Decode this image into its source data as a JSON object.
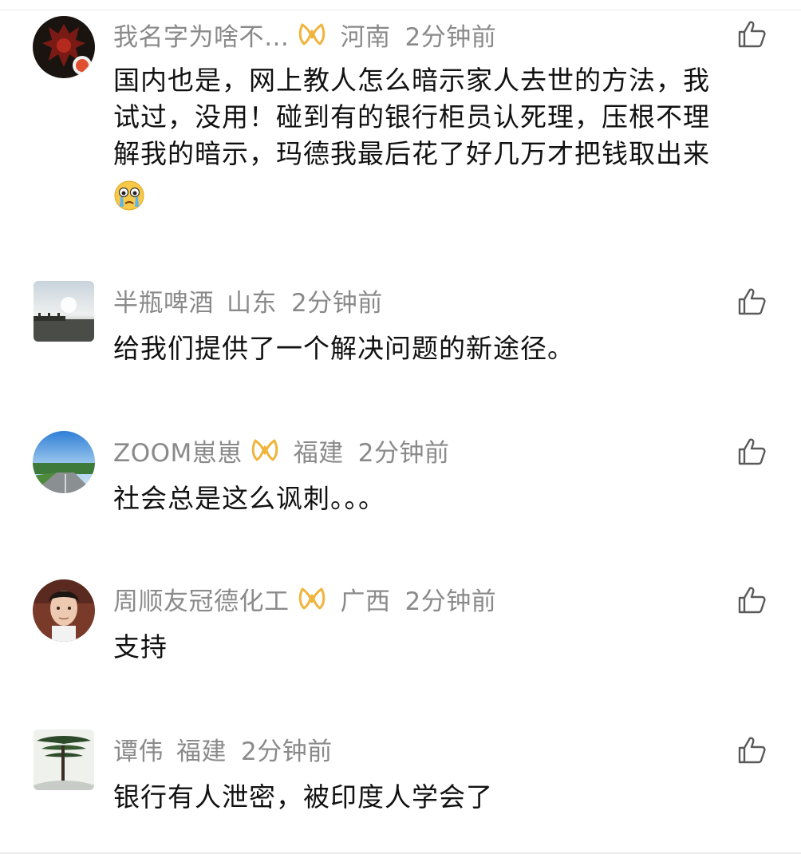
{
  "comments": [
    {
      "name": "我名字为啥不…",
      "location": "河南",
      "time": "2分钟前",
      "badge": "yellow-loop-badge",
      "avatar": "red-horde-emblem-avatar",
      "text_lines": [
        "国内也是，网上教人怎么暗示家人去世的方法，我",
        "试过，没用！碰到有的银行柜员认死理，压根不理",
        "解我的暗示，玛德我最后花了好几万才把钱取出来"
      ],
      "emoji": "crying-emoji"
    },
    {
      "name": "半瓶啤酒",
      "location": "山东",
      "time": "2分钟前",
      "avatar": "sky-bridge-photo-avatar",
      "text": "给我们提供了一个解决问题的新途径。"
    },
    {
      "name": "ZOOM崽崽",
      "location": "福建",
      "time": "2分钟前",
      "badge": "yellow-loop-badge",
      "avatar": "road-sky-photo-avatar",
      "text": "社会总是这么讽刺。。。"
    },
    {
      "name": "周顺友冠德化工",
      "location": "广西",
      "time": "2分钟前",
      "badge": "yellow-loop-badge",
      "avatar": "portrait-photo-avatar",
      "text": "支持"
    },
    {
      "name": "谭伟",
      "location": "福建",
      "time": "2分钟前",
      "avatar": "pine-tree-photo-avatar",
      "text": "银行有人泄密，被印度人学会了"
    }
  ],
  "colors": {
    "meta_text": "#8a8a8a",
    "body_text": "#111111",
    "badge": "#f0b43c",
    "like_icon": "#5a5a5a"
  }
}
